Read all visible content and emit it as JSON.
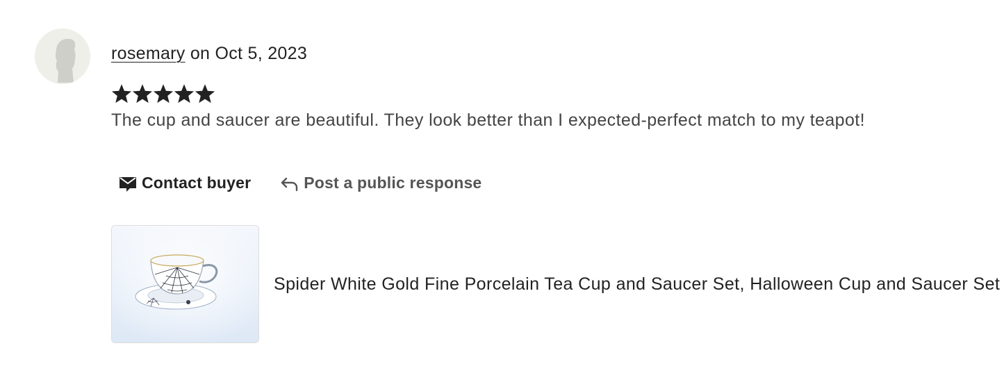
{
  "review": {
    "username": "rosemary",
    "date_prefix": " on ",
    "date": "Oct 5, 2023",
    "rating": 5,
    "rating_max": 5,
    "text": "The cup and saucer are beautiful. They look better than I expected-perfect match to my teapot!",
    "avatar_icon": "default-avatar-silhouette"
  },
  "actions": {
    "contact_label": "Contact buyer",
    "contact_icon": "envelope-icon",
    "respond_label": "Post a public response",
    "respond_icon": "reply-arrow-icon"
  },
  "product": {
    "title": "Spider White Gold Fine Porcelain Tea Cup and Saucer Set, Halloween Cup and Saucer Set",
    "image_subject": "white porcelain tea cup with spider web pattern on saucer"
  },
  "colors": {
    "text_primary": "#222222",
    "text_secondary": "#444444",
    "star": "#222222",
    "avatar_bg": "#efefea",
    "avatar_figure": "#cfcfca"
  }
}
